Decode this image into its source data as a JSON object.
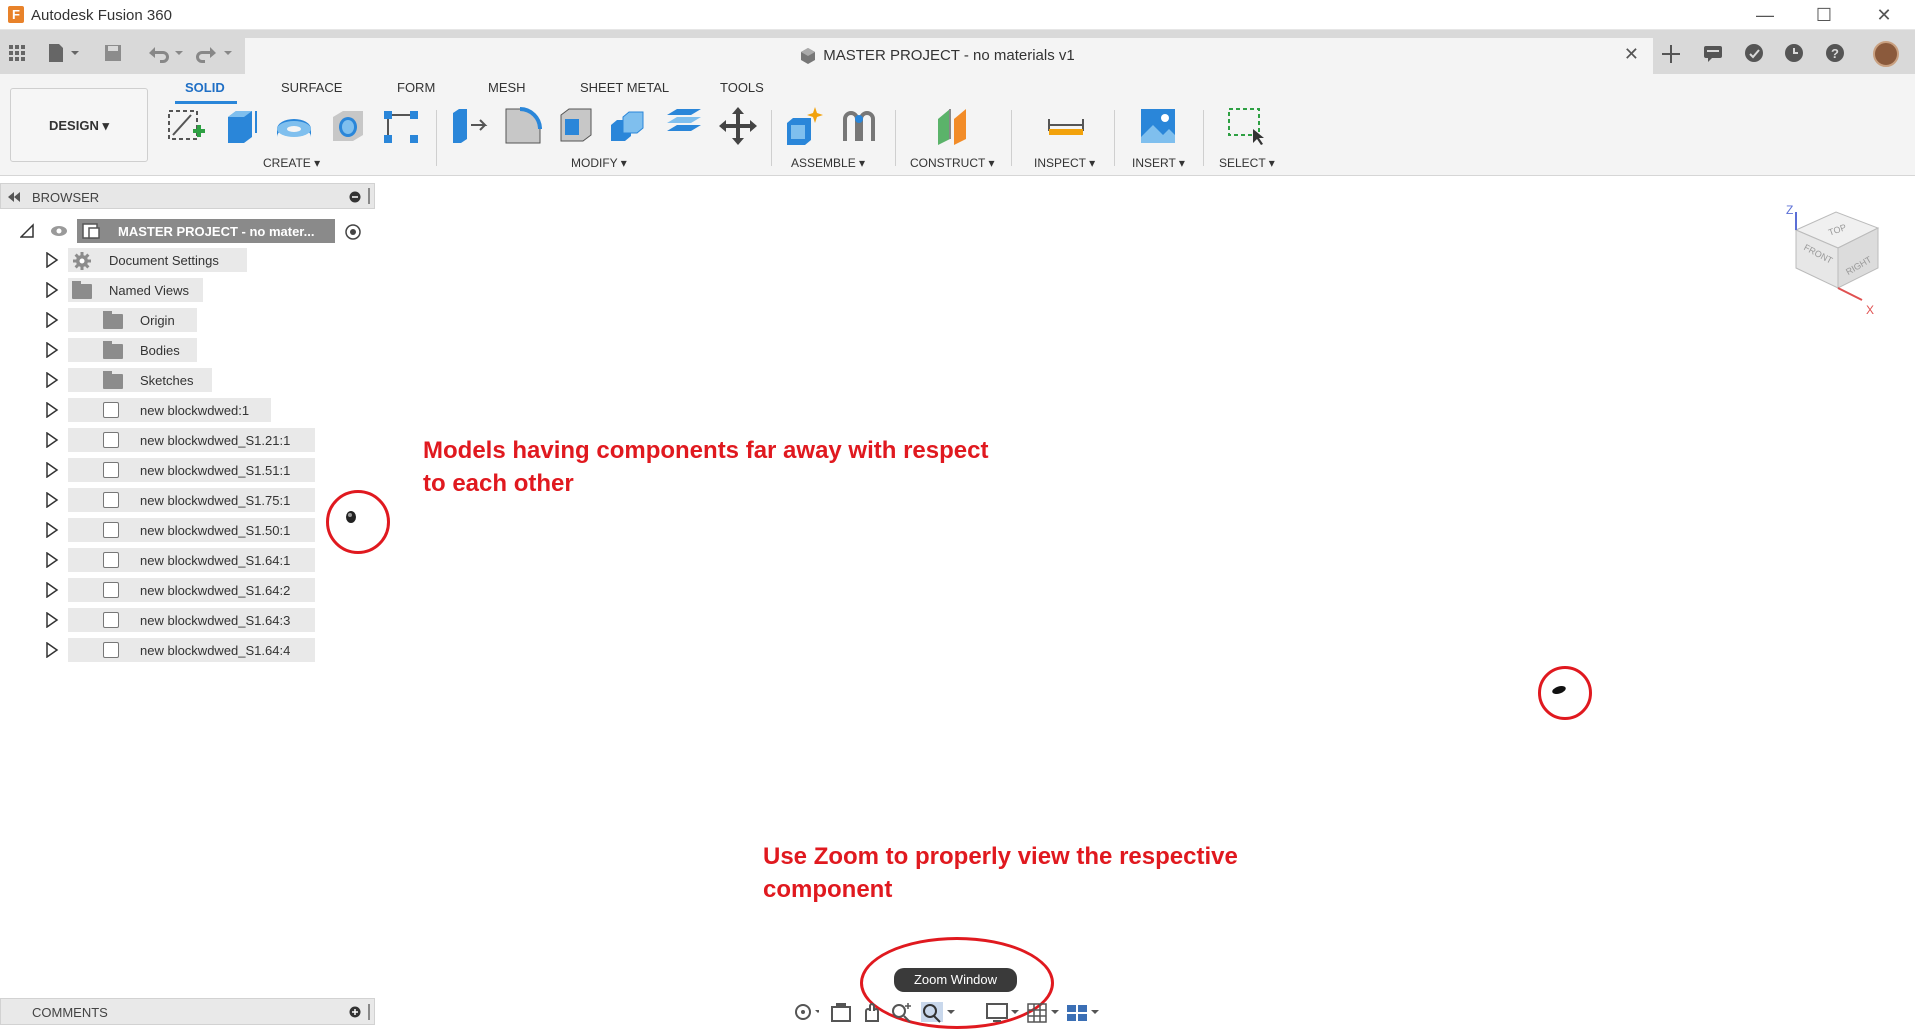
{
  "window": {
    "app_title": "Autodesk Fusion 360",
    "logo_letter": "F",
    "document_title": "MASTER PROJECT - no materials v1",
    "controls": {
      "minimize": "—",
      "maximize": "☐",
      "close": "✕"
    }
  },
  "ribbon": {
    "workspace": "DESIGN",
    "tabs": [
      "SOLID",
      "SURFACE",
      "FORM",
      "MESH",
      "SHEET METAL",
      "TOOLS"
    ],
    "active_tab": "SOLID",
    "groups": [
      "CREATE",
      "MODIFY",
      "ASSEMBLE",
      "CONSTRUCT",
      "INSPECT",
      "INSERT",
      "SELECT"
    ]
  },
  "browser": {
    "title": "BROWSER",
    "root": "MASTER PROJECT - no mater...",
    "items": [
      {
        "label": "Document Settings",
        "icon": "gear-icon"
      },
      {
        "label": "Named Views",
        "icon": "folder-icon"
      },
      {
        "label": "Origin",
        "icon": "folder-icon"
      },
      {
        "label": "Bodies",
        "icon": "folder-icon"
      },
      {
        "label": "Sketches",
        "icon": "folder-icon"
      },
      {
        "label": "new blockwdwed:1",
        "icon": "component-icon"
      },
      {
        "label": "new blockwdwed_S1.21:1",
        "icon": "component-icon"
      },
      {
        "label": "new blockwdwed_S1.51:1",
        "icon": "component-icon"
      },
      {
        "label": "new blockwdwed_S1.75:1",
        "icon": "component-icon"
      },
      {
        "label": "new blockwdwed_S1.50:1",
        "icon": "component-icon"
      },
      {
        "label": "new blockwdwed_S1.64:1",
        "icon": "component-icon"
      },
      {
        "label": "new blockwdwed_S1.64:2",
        "icon": "component-icon"
      },
      {
        "label": "new blockwdwed_S1.64:3",
        "icon": "component-icon"
      },
      {
        "label": "new blockwdwed_S1.64:4",
        "icon": "component-icon"
      }
    ]
  },
  "annotations": {
    "top_line1": "Models having components far away with respect",
    "top_line2": "to each other",
    "bottom_line1": "Use Zoom to properly view the respective",
    "bottom_line2": "component",
    "color": "#e0191f"
  },
  "viewcube": {
    "top": "TOP",
    "front": "FRONT",
    "right": "RIGHT",
    "axis_z": "Z",
    "axis_x": "X"
  },
  "comments": {
    "title": "COMMENTS"
  },
  "tooltip": "Zoom Window",
  "colors": {
    "accent": "#1f6fc5",
    "ribbon_bg": "#f4f4f4",
    "tabbar_bg": "#d9d9d9"
  }
}
